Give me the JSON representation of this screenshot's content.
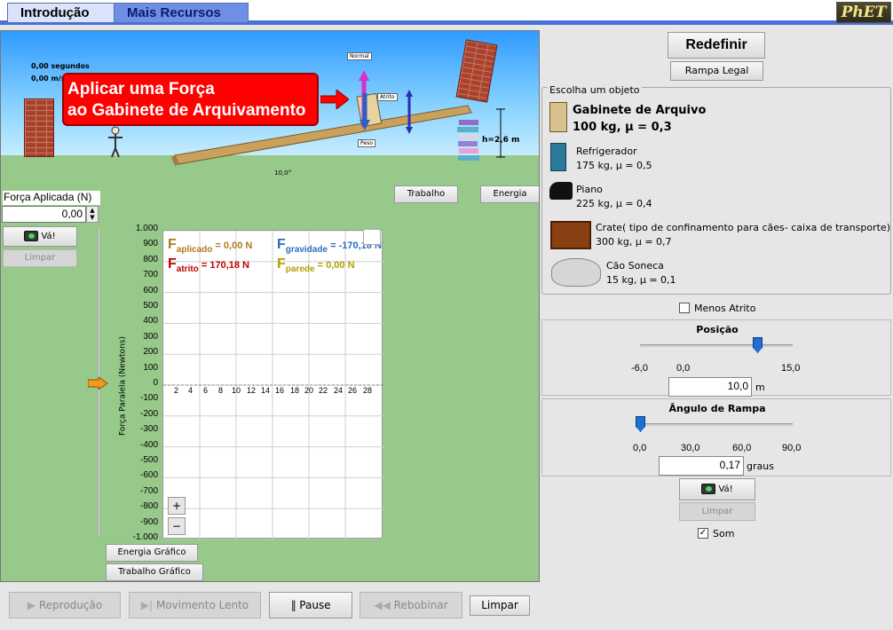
{
  "tabs": {
    "intro": "Introdução",
    "more": "Mais Recursos",
    "logo": "PhET"
  },
  "scene": {
    "time": "0,00 segundos",
    "speed": "0,00 m/s",
    "apply_line1": "Aplicar uma Força",
    "apply_line2": "ao Gabinete de Arquivamento",
    "normal_label": "Normal",
    "friction_label": "Atrito",
    "weight_label": "Peso",
    "height_label": "h=2,6 m",
    "angle_label": "10,0°",
    "work_button": "Trabalho",
    "energy_button": "Energia"
  },
  "applied_force": {
    "label": "Força Aplicada (N)",
    "value": "0,00",
    "go": "Vá!",
    "clear": "Limpar"
  },
  "graph": {
    "y_title": "Força Paralela (Newtons)",
    "y_ticks": [
      "1.000",
      "900",
      "800",
      "700",
      "600",
      "500",
      "400",
      "300",
      "200",
      "100",
      "0",
      "-100",
      "-200",
      "-300",
      "-400",
      "-500",
      "-600",
      "-700",
      "-800",
      "-900",
      "-1.000"
    ],
    "x_ticks": [
      "2",
      "4",
      "6",
      "8",
      "10",
      "12",
      "14",
      "16",
      "18",
      "20",
      "22",
      "24",
      "26",
      "28"
    ],
    "legend": {
      "applied_F": "F",
      "applied_sub": "aplicado",
      "applied_val": "= 0,00 N",
      "friction_F": "F",
      "friction_sub": "atrito",
      "friction_val": "= 170,18 N",
      "gravity_F": "F",
      "gravity_sub": "gravidade",
      "gravity_val": "= -170,18 N",
      "wall_F": "F",
      "wall_sub": "parede",
      "wall_val": "= 0,00 N"
    },
    "energy_graph": "Energia Gráfico",
    "work_graph": "Trabalho Gráfico"
  },
  "playback": {
    "replay": "Reprodução",
    "slow": "Movimento Lento",
    "pause": "Pause",
    "rewind": "Rebobinar",
    "clear": "Limpar"
  },
  "right": {
    "reset": "Redefinir",
    "legal_ramp": "Rampa Legal",
    "choose_title": "Escolha um objeto",
    "objects": [
      {
        "name": "Gabinete de Arquivo",
        "info": "100 kg, μ = 0,3"
      },
      {
        "name": "Refrigerador",
        "info": "175 kg, μ = 0,5"
      },
      {
        "name": "Piano",
        "info": "225 kg, μ = 0,4"
      },
      {
        "name": "Crate( tipo de confinamento para cães- caixa de transporte)",
        "info": "300 kg, μ = 0,7"
      },
      {
        "name": "Cão Soneca",
        "info": "15 kg, μ = 0,1"
      }
    ],
    "less_friction": "Menos Atrito",
    "position_title": "Posição",
    "position_ticks": [
      "-6,0",
      "0,0",
      "15,0"
    ],
    "position_value": "10,0",
    "position_unit": "m",
    "ramp_title": "Ângulo de Rampa",
    "ramp_ticks": [
      "0,0",
      "30,0",
      "60,0",
      "90,0"
    ],
    "ramp_value": "0,17",
    "ramp_unit": "graus",
    "go": "Vá!",
    "clear": "Limpar",
    "sound": "Som"
  }
}
